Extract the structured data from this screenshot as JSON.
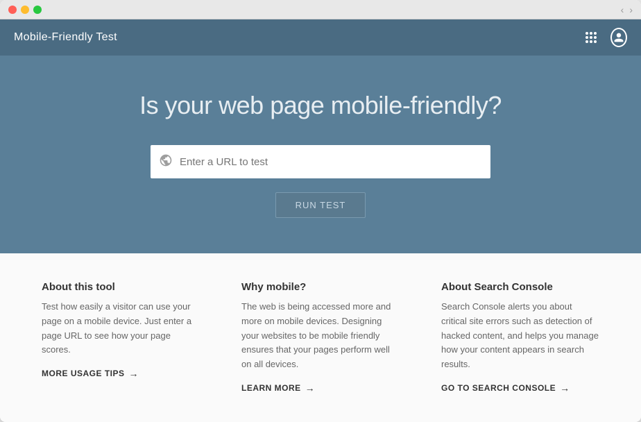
{
  "window": {
    "traffic_lights": [
      "close",
      "minimize",
      "maximize"
    ],
    "nav_back": "‹",
    "nav_forward": "›"
  },
  "header": {
    "title": "Mobile-Friendly Test",
    "grid_icon_label": "apps",
    "user_icon_label": "account"
  },
  "hero": {
    "title": "Is your web page mobile-friendly?",
    "url_placeholder": "Enter a URL to test",
    "run_button_label": "RUN TEST"
  },
  "info": {
    "columns": [
      {
        "id": "about-tool",
        "title": "About this tool",
        "text": "Test how easily a visitor can use your page on a mobile device. Just enter a page URL to see how your page scores.",
        "link_label": "MORE USAGE TIPS",
        "link_arrow": "→"
      },
      {
        "id": "why-mobile",
        "title": "Why mobile?",
        "text": "The web is being accessed more and more on mobile devices. Designing your websites to be mobile friendly ensures that your pages perform well on all devices.",
        "link_label": "LEARN MORE",
        "link_arrow": "→"
      },
      {
        "id": "about-console",
        "title": "About Search Console",
        "text": "Search Console alerts you about critical site errors such as detection of hacked content, and helps you manage how your content appears in search results.",
        "link_label": "GO TO SEARCH CONSOLE",
        "link_arrow": "→"
      }
    ]
  }
}
